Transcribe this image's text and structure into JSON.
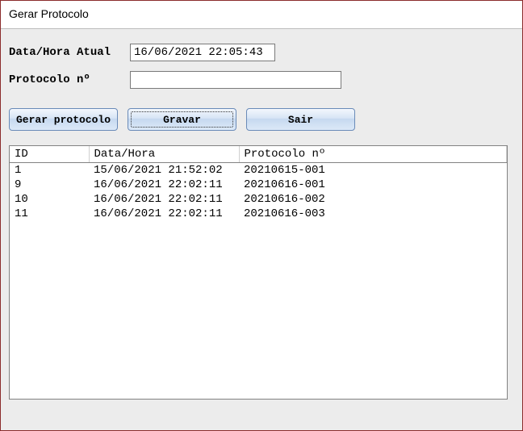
{
  "window": {
    "title": "Gerar Protocolo"
  },
  "form": {
    "datetime_label": "Data/Hora Atual",
    "datetime_value": "16/06/2021 22:05:43",
    "protocol_label": "Protocolo nº",
    "protocol_value": ""
  },
  "buttons": {
    "generate": "Gerar protocolo",
    "save": "Gravar",
    "exit": "Sair"
  },
  "grid": {
    "headers": {
      "id": "ID",
      "datetime": "Data/Hora",
      "protocol": "Protocolo nº"
    },
    "rows": [
      {
        "id": "1",
        "datetime": "15/06/2021 21:52:02",
        "protocol": "20210615-001"
      },
      {
        "id": "9",
        "datetime": "16/06/2021 22:02:11",
        "protocol": "20210616-001"
      },
      {
        "id": "10",
        "datetime": "16/06/2021 22:02:11",
        "protocol": "20210616-002"
      },
      {
        "id": "11",
        "datetime": "16/06/2021 22:02:11",
        "protocol": "20210616-003"
      }
    ]
  }
}
